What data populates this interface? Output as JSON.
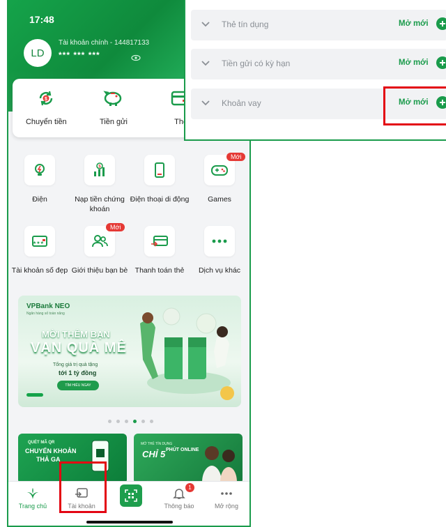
{
  "status": {
    "time": "17:48"
  },
  "account": {
    "avatar_initials": "LD",
    "name_label": "Tài khoản chính - 144817133",
    "masked_balance": "*** *** ***"
  },
  "quick_actions": [
    {
      "label": "Chuyển tiền",
      "icon": "transfer-icon"
    },
    {
      "label": "Tiền gửi",
      "icon": "piggy-bank-icon"
    },
    {
      "label": "Thẻ",
      "icon": "card-icon"
    }
  ],
  "services": [
    {
      "label": "Điện",
      "icon": "electricity-icon",
      "badge": ""
    },
    {
      "label": "Nạp tiền chứng khoán",
      "icon": "stock-topup-icon",
      "badge": ""
    },
    {
      "label": "Điện thoại di động",
      "icon": "mobile-phone-icon",
      "badge": ""
    },
    {
      "label": "Games",
      "icon": "gamepad-icon",
      "badge": "Mới"
    },
    {
      "label": "Tài khoản số đẹp",
      "icon": "nice-number-icon",
      "badge": ""
    },
    {
      "label": "Giới thiệu bạn bè",
      "icon": "refer-friends-icon",
      "badge": "Mới"
    },
    {
      "label": "Thanh toán thẻ",
      "icon": "card-payment-icon",
      "badge": ""
    },
    {
      "label": "Dịch vụ khác",
      "icon": "more-services-icon",
      "badge": ""
    }
  ],
  "banner": {
    "brand": "VPBank NEO",
    "brand_sub": "Ngân hàng số toàn năng",
    "line1": "MỜI THÊM BẠN",
    "line2": "VẠN QUÀ MÊ",
    "line3": "Tổng giá trị quà tặng",
    "line4": "tới 1 tỷ đồng",
    "cta": "TÌM HIỂU NGAY",
    "dots_total": 6,
    "dots_active_index": 3
  },
  "promos": [
    {
      "line1": "QUÉT MÃ QR",
      "line2": "CHUYỂN KHOẢN",
      "line3": "THẢ GA"
    },
    {
      "line1": "MỞ THẺ TÍN DỤNG",
      "line2": "CHỈ 5",
      "line3": "PHÚT ONLINE"
    }
  ],
  "tabbar": {
    "items": [
      {
        "label": "Trang chủ",
        "icon": "home-icon",
        "active": true
      },
      {
        "label": "Tài khoản",
        "icon": "account-icon",
        "active": false
      },
      {
        "label": "",
        "icon": "qr-scan-icon",
        "active": false
      },
      {
        "label": "Thông báo",
        "icon": "bell-icon",
        "active": false
      },
      {
        "label": "Mở rộng",
        "icon": "more-icon",
        "active": false
      }
    ],
    "notification_count": "1"
  },
  "products": [
    {
      "title": "Thẻ tín dụng",
      "action": "Mở mới"
    },
    {
      "title": "Tiền gửi có kỳ hạn",
      "action": "Mở mới"
    },
    {
      "title": "Khoản vay",
      "action": "Mở mới"
    }
  ],
  "colors": {
    "brand_green": "#1a9b4b",
    "highlight_red": "#e30613",
    "badge_red": "#e53935"
  }
}
